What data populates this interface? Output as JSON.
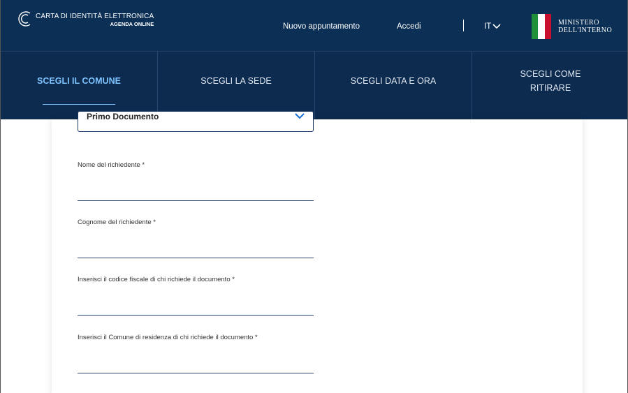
{
  "header": {
    "brand_title": "CARTA DI IDENTITÀ ELETTRONICA",
    "brand_subtitle": "AGENDA ONLINE",
    "nav_new_appointment": "Nuovo appuntamento",
    "nav_login": "Accedi",
    "language": "IT",
    "ministry_line1": "MINISTERO",
    "ministry_line2": "DELL'INTERNO"
  },
  "colors": {
    "header_bg": "#0b2f55",
    "steps_bg": "#0d2b4f",
    "active_step": "#7ec3ff",
    "flag_green": "#1f8f3a",
    "flag_white": "#ffffff",
    "flag_red": "#c8102e"
  },
  "steps": [
    {
      "label": "SCEGLI IL COMUNE",
      "active": true
    },
    {
      "label": "SCEGLI LA SEDE",
      "active": false
    },
    {
      "label": "SCEGLI DATA E ORA",
      "active": false
    },
    {
      "label": "SCEGLI COME RITIRARE",
      "active": false
    }
  ],
  "form": {
    "document_type_value": "Primo Documento",
    "fields": [
      {
        "label": "Nome del richiedente *",
        "value": ""
      },
      {
        "label": "Cognome del richiedente *",
        "value": ""
      },
      {
        "label": "Inserisci il codice fiscale di chi richiede il documento *",
        "value": ""
      },
      {
        "label": "Inserisci il Comune di residenza di chi richiede il documento *",
        "value": ""
      }
    ]
  },
  "icons": {
    "logo": "cie-logo-icon",
    "lang_chevron": "chevron-down-icon",
    "select_chevron": "chevron-down-icon"
  }
}
